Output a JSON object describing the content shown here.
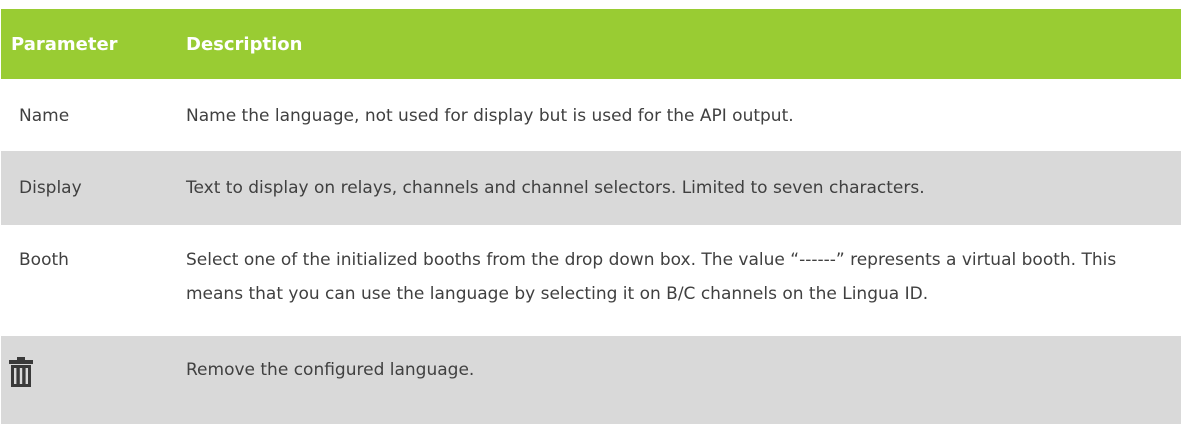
{
  "table": {
    "headers": {
      "parameter": "Parameter",
      "description": "Description"
    },
    "rows": [
      {
        "parameter": "Name",
        "description": "Name the language, not used for display but is used for the API output."
      },
      {
        "parameter": "Display",
        "description": "Text to display on relays, channels and channel selectors. Limited to seven characters."
      },
      {
        "parameter": "Booth",
        "description": "Select one of the initialized booths from the drop down box. The value “------” represents a virtual booth. This means that you can use the language by selecting it on B/C channels on the Lingua ID."
      },
      {
        "parameter_icon": "trash-icon",
        "description": "Remove the configured language."
      }
    ]
  },
  "colors": {
    "header_background": "#99cc33",
    "header_text": "#ffffff",
    "row_alt_background": "#d9d9d9",
    "body_text": "#404040"
  }
}
